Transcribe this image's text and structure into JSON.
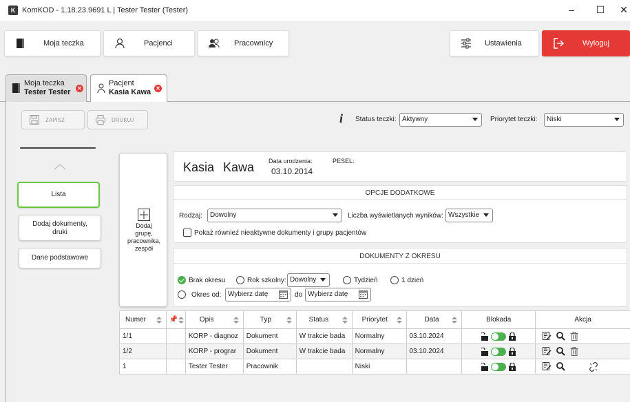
{
  "window": {
    "title": "KomKOD - 1.18.23.9691 L | Tester Tester (Tester)",
    "icon_letter": "K",
    "minimize": "–",
    "maximize": "☐",
    "close": "✕"
  },
  "nav": {
    "moja_teczka": "Moja teczka",
    "pacjenci": "Pacjenci",
    "pracownicy": "Pracownicy",
    "ustawienia": "Ustawienia",
    "wyloguj": "Wyloguj"
  },
  "tabs": [
    {
      "line1": "Moja teczka",
      "line2": "Tester Tester"
    },
    {
      "line1": "Pacjent",
      "line2": "Kasia Kawa"
    }
  ],
  "toolbar": {
    "zapisz": "ZAPISZ",
    "drukuj": "DRUKUJ",
    "info_glyph": "i",
    "status_label": "Status teczki:",
    "status_value": "Aktywny",
    "priority_label": "Priorytet teczki:",
    "priority_value": "Niski"
  },
  "sidebar": {
    "items": [
      "Lista",
      "Dodaj dokumenty,\ndruki",
      "Dane podstawowe"
    ]
  },
  "add_group": {
    "label": "Dodaj\ngrupę,\npracownika,\nzespół"
  },
  "patient": {
    "first_name": "Kasia",
    "last_name": "Kawa",
    "dob_label": "Data urodzenia:",
    "dob": "03.10.2014",
    "pesel_label": "PESEL:"
  },
  "options": {
    "title": "OPCJE DODATKOWE",
    "rodzaj_label": "Rodzaj:",
    "rodzaj_value": "Dowolny",
    "limit_label": "Liczba wyświetlanych wyników:",
    "limit_value": "Wszystkie",
    "inactive_label": "Pokaż również nieaktywne dokumenty i grupy pacjentów"
  },
  "period": {
    "title": "DOKUMENTY Z OKRESU",
    "brak": "Brak okresu",
    "rok": "Rok szkolny:",
    "rok_value": "Dowolny",
    "tydzien": "Tydzień",
    "dzien": "1 dzień",
    "okres_od": "Okres od:",
    "pick_date": "Wybierz datę",
    "do": "do"
  },
  "table": {
    "headers": [
      "Numer",
      "",
      "Opis",
      "Typ",
      "Status",
      "Priorytet",
      "Data",
      "Blokada",
      "Akcja"
    ],
    "pin_glyph": "📌",
    "rows": [
      {
        "numer": "1/1",
        "opis": "KORP - diagnoz",
        "typ": "Dokument",
        "status": "W trakcie bada",
        "priorytet": "Normalny",
        "data": "03.10.2024"
      },
      {
        "numer": "1/2",
        "opis": "KORP - prograr",
        "typ": "Dokument",
        "status": "W trakcie bada",
        "priorytet": "Normalny",
        "data": "03.10.2024"
      },
      {
        "numer": "1",
        "opis": "Tester Tester",
        "typ": "Pracownik",
        "status": "",
        "priorytet": "Niski",
        "data": ""
      }
    ]
  },
  "colors": {
    "accent_green": "#4caf50",
    "logout_red": "#e53935"
  }
}
